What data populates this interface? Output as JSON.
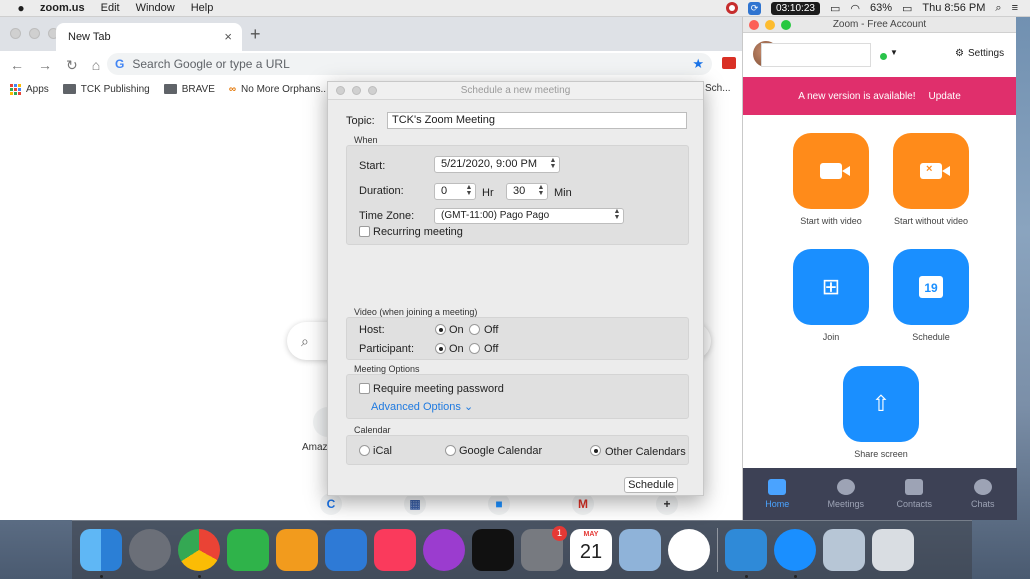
{
  "menubar": {
    "app_name": "zoom.us",
    "menus": [
      "Edit",
      "Window",
      "Help"
    ],
    "timer": "03:10:23",
    "battery": "63%",
    "clock": "Thu 8:56 PM"
  },
  "chrome": {
    "tab_title": "New Tab",
    "omnibox_placeholder": "Search Google or type a URL",
    "bookmarks": [
      "Apps",
      "TCK Publishing",
      "BRAVE",
      "No More Orphans..."
    ],
    "bookmark_overflow": "Sch...",
    "shortcut_label": "Amaz"
  },
  "dialog": {
    "title": "Schedule a new meeting",
    "topic_label": "Topic:",
    "topic_value": "TCK's Zoom Meeting",
    "when_title": "When",
    "start_label": "Start:",
    "start_value": "5/21/2020,   9:00 PM",
    "duration_label": "Duration:",
    "duration_hr": "0",
    "hr_label": "Hr",
    "duration_min": "30",
    "min_label": "Min",
    "timezone_label": "Time Zone:",
    "timezone_value": "(GMT-11:00) Pago Pago",
    "recurring_label": "Recurring meeting",
    "video_title": "Video (when joining a meeting)",
    "host_label": "Host:",
    "participant_label": "Participant:",
    "on_label": "On",
    "off_label": "Off",
    "options_title": "Meeting Options",
    "password_label": "Require meeting password",
    "advanced_label": "Advanced Options",
    "calendar_title": "Calendar",
    "ical_label": "iCal",
    "google_label": "Google Calendar",
    "other_label": "Other Calendars",
    "schedule_button": "Schedule"
  },
  "zoom": {
    "window_title": "Zoom - Free Account",
    "settings_label": "Settings",
    "banner_text": "A new version is available!",
    "update_label": "Update",
    "start_video_label": "Start with video",
    "start_no_video_label": "Start without video",
    "join_label": "Join",
    "schedule_label": "Schedule",
    "schedule_day": "19",
    "share_label": "Share screen",
    "nav": [
      "Home",
      "Meetings",
      "Contacts",
      "Chats"
    ],
    "colors": {
      "orange": "#ff8b1a",
      "blue": "#1a8fff",
      "banner": "#e02f6c",
      "nav_bg": "#3d4155"
    }
  },
  "dock": {
    "calendar_month": "MAY",
    "calendar_day": "21",
    "settings_badge": "1",
    "icons": [
      "finder-icon",
      "launchpad-icon",
      "chrome-icon",
      "numbers-icon",
      "pages-icon",
      "keynote-icon",
      "music-icon",
      "podcasts-icon",
      "apple-tv-icon",
      "system-preferences-icon",
      "calendar-icon",
      "preview-icon",
      "slack-icon",
      "app-icon",
      "zoom-icon",
      "photo-icon",
      "trash-icon"
    ]
  }
}
